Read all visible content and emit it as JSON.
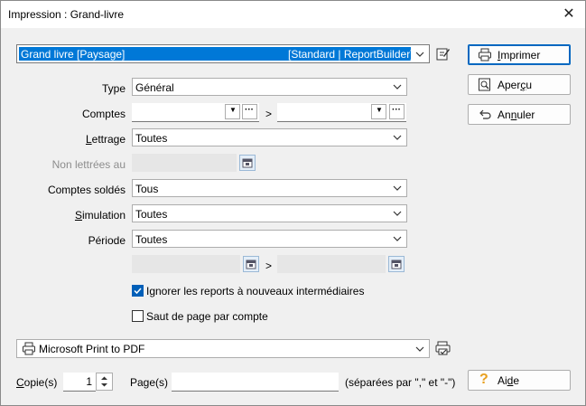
{
  "window": {
    "title": "Impression : Grand-livre",
    "close_glyph": "✕"
  },
  "report": {
    "selected_name": "Grand livre [Paysage]",
    "selected_engine": "[Standard | ReportBuilder]"
  },
  "form": {
    "type": {
      "label": "Type",
      "value": "Général"
    },
    "comptes": {
      "label": "Comptes",
      "separator": ">"
    },
    "lettrage": {
      "label_prefix": "L",
      "label_rest": "ettrage",
      "value": "Toutes"
    },
    "non_lettrees": {
      "label": "Non lettrées au",
      "value": ""
    },
    "comptes_soldes": {
      "label": "Comptes soldés",
      "value": "Tous"
    },
    "simulation": {
      "label_prefix": "S",
      "label_rest": "imulation",
      "value": "Toutes"
    },
    "periode": {
      "label": "Période",
      "value": "Toutes",
      "separator": ">"
    },
    "ignorer_reports": {
      "label": "Ignorer les reports à nouveaux intermédiaires",
      "checked": true
    },
    "saut_de_page": {
      "label": "Saut de page par compte",
      "checked": false
    }
  },
  "buttons": {
    "imprimer": {
      "prefix": "I",
      "rest": "mprimer"
    },
    "apercu": {
      "prefix": "Aper",
      "u": "ç",
      "rest": "u"
    },
    "annuler": {
      "prefix": "An",
      "u": "n",
      "rest": "uler"
    },
    "aide": {
      "prefix": "Ai",
      "u": "d",
      "rest": "e"
    }
  },
  "printer": {
    "name": "Microsoft Print to PDF"
  },
  "copies": {
    "label_prefix": "C",
    "label_rest": "opie(s)",
    "value": "1"
  },
  "pages": {
    "label": "Page(s)",
    "value": "",
    "hint": "(séparées par \",\" et \"-\")"
  },
  "colors": {
    "accent": "#0067c0",
    "checkbox": "#005fb8",
    "selection": "#0078d7",
    "help_icon": "#e8a020"
  },
  "icons": {
    "ellipsis": "···",
    "dropdown": "▼",
    "edit": "edit-icon",
    "calendar": "calendar-icon",
    "printer": "printer-icon",
    "preview": "magnifier-icon",
    "undo": "undo-arrow-icon",
    "help": "question-mark-icon"
  }
}
